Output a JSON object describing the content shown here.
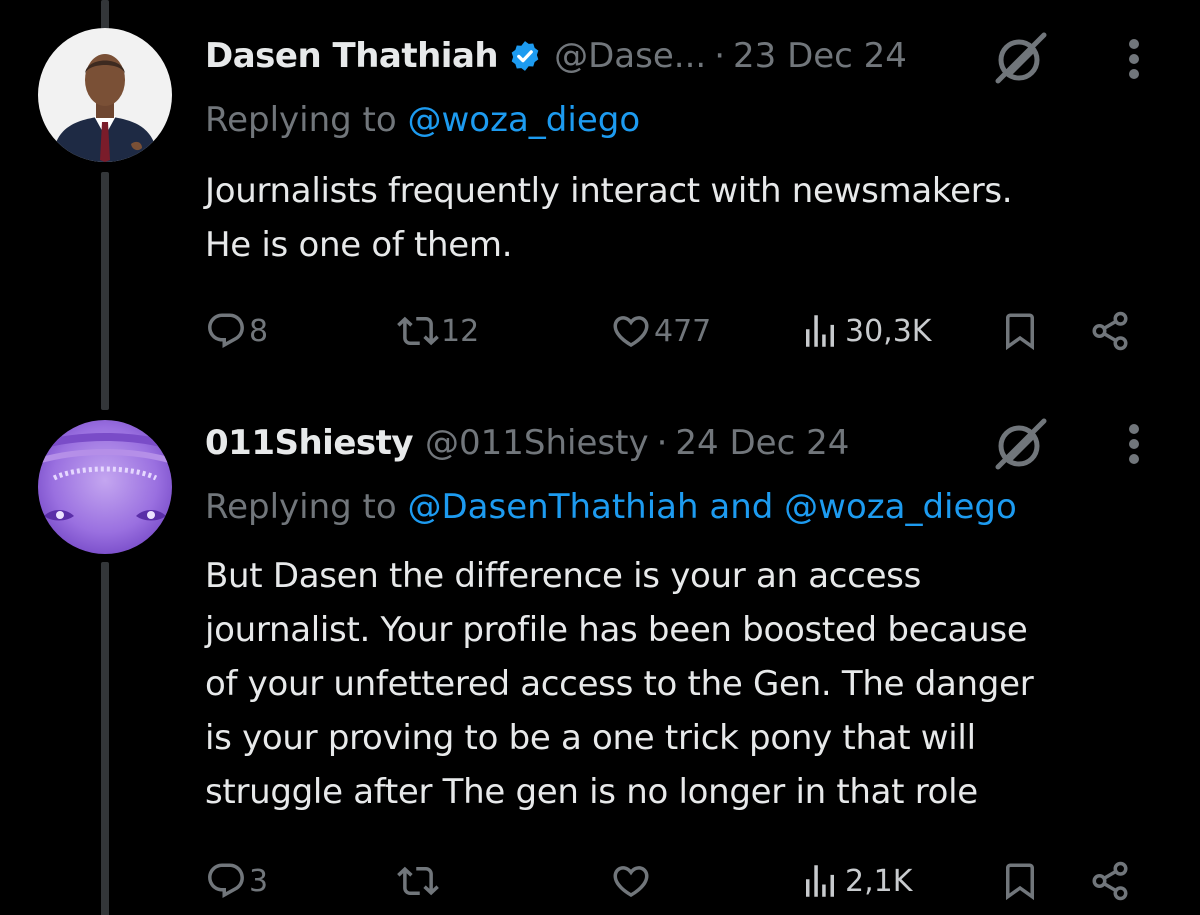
{
  "tweets": [
    {
      "display_name": "Dasen Thathiah",
      "verified": true,
      "handle": "@Dase...",
      "separator": "·",
      "date": "23 Dec 24",
      "replying_prefix": "Replying to",
      "replying_to": "@woza_diego",
      "replying_conj": "",
      "replying_to_2": "",
      "text_lines": [
        "Journalists frequently interact with newsmakers.",
        "He is one of them."
      ],
      "replies": "8",
      "reposts": "12",
      "likes": "477",
      "views": "30,3K"
    },
    {
      "display_name": "011Shiesty",
      "verified": false,
      "handle": "@011Shiesty",
      "separator": "·",
      "date": "24 Dec 24",
      "replying_prefix": "Replying to",
      "replying_to": "@DasenThathiah",
      "replying_conj": "and",
      "replying_to_2": "@woza_diego",
      "text_lines": [
        "But Dasen the difference is your an access",
        "journalist. Your profile has been boosted because",
        "of your unfettered access to the Gen. The danger",
        "is your proving to be a one trick pony that will",
        "struggle after The gen is no longer in that role"
      ],
      "replies": "3",
      "reposts": "",
      "likes": "",
      "views": "2,1K"
    }
  ],
  "icons": [
    "reply-icon",
    "repost-icon",
    "like-icon",
    "views-icon",
    "bookmark-icon",
    "share-icon",
    "grok-icon",
    "more-icon",
    "verified-badge-icon"
  ],
  "colors": {
    "background": "#000000",
    "text": "#e7e9ea",
    "muted": "#71767b",
    "link": "#1d9bf0",
    "thread_line": "#333639"
  }
}
